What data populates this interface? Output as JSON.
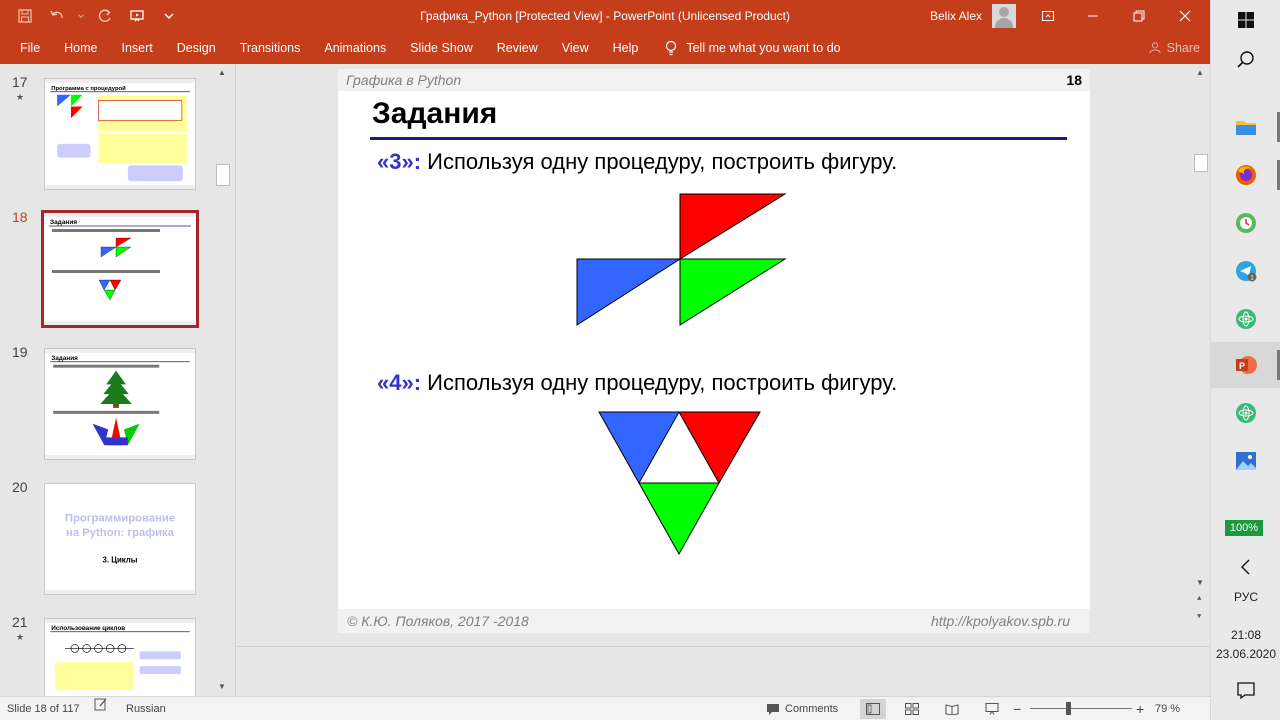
{
  "window": {
    "title": "Графика_Python [Protected View]  -  PowerPoint (Unlicensed Product)",
    "user": "Belix Alex"
  },
  "ribbon": {
    "tabs": [
      "File",
      "Home",
      "Insert",
      "Design",
      "Transitions",
      "Animations",
      "Slide Show",
      "Review",
      "View",
      "Help"
    ],
    "tell_me": "Tell me what you want to do",
    "share": "Share"
  },
  "thumbnails": [
    {
      "number": "17",
      "star": "★",
      "title": "Программа с процедурой"
    },
    {
      "number": "18",
      "star": "★",
      "title": "Задания",
      "selected": true
    },
    {
      "number": "19",
      "title": "Задания"
    },
    {
      "number": "20",
      "line1": "Программирование",
      "line2": "на Python: графика",
      "subtitle": "3. Циклы"
    },
    {
      "number": "21",
      "star": "★",
      "title": "Использование циклов"
    }
  ],
  "slide": {
    "header": "Графика в Python",
    "number": "18",
    "title": "Задания",
    "tasks": [
      {
        "label": "«3»:",
        "text": " Используя одну процедуру, построить фигуру."
      },
      {
        "label": "«4»:",
        "text": " Используя одну процедуру, построить фигуру."
      }
    ],
    "footer_left": "© К.Ю. Поляков, 2017 -2018",
    "footer_right": "http://kpolyakov.spb.ru"
  },
  "statusbar": {
    "slide_info": "Slide 18 of 117",
    "language": "Russian",
    "comments": "Comments",
    "zoom": "79 %"
  },
  "system": {
    "battery": "100%",
    "input_lang": "РУС",
    "time": "21:08",
    "date": "23.06.2020"
  },
  "colors": {
    "accent": "#c43e1c",
    "fig_red": "#ff0000",
    "fig_blue": "#3366ff",
    "fig_green": "#00ff00",
    "task_label": "#3333cc"
  }
}
